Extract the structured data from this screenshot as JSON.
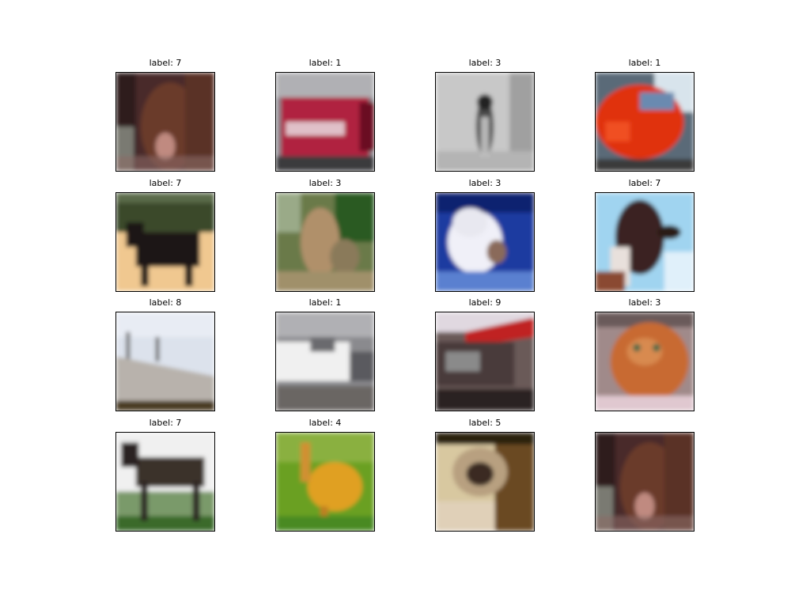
{
  "figure": {
    "panels": [
      {
        "title": "label: 7",
        "scene": "horse-closeup"
      },
      {
        "title": "label: 1",
        "scene": "red-car-front"
      },
      {
        "title": "label: 3",
        "scene": "grey-cat"
      },
      {
        "title": "label: 1",
        "scene": "orange-sports-car"
      },
      {
        "title": "label: 7",
        "scene": "dark-horse-sand"
      },
      {
        "title": "label: 3",
        "scene": "tabby-cat-garden"
      },
      {
        "title": "label: 3",
        "scene": "white-cat-blue"
      },
      {
        "title": "label: 7",
        "scene": "horse-head-sky"
      },
      {
        "title": "label: 8",
        "scene": "ship-side"
      },
      {
        "title": "label: 1",
        "scene": "white-truck"
      },
      {
        "title": "label: 9",
        "scene": "dark-truck"
      },
      {
        "title": "label: 3",
        "scene": "orange-cat-face"
      },
      {
        "title": "label: 7",
        "scene": "horse-grass"
      },
      {
        "title": "label: 4",
        "scene": "yellow-deer"
      },
      {
        "title": "label: 5",
        "scene": "pug-dog"
      },
      {
        "title": "",
        "scene": "horse-closeup"
      }
    ]
  }
}
